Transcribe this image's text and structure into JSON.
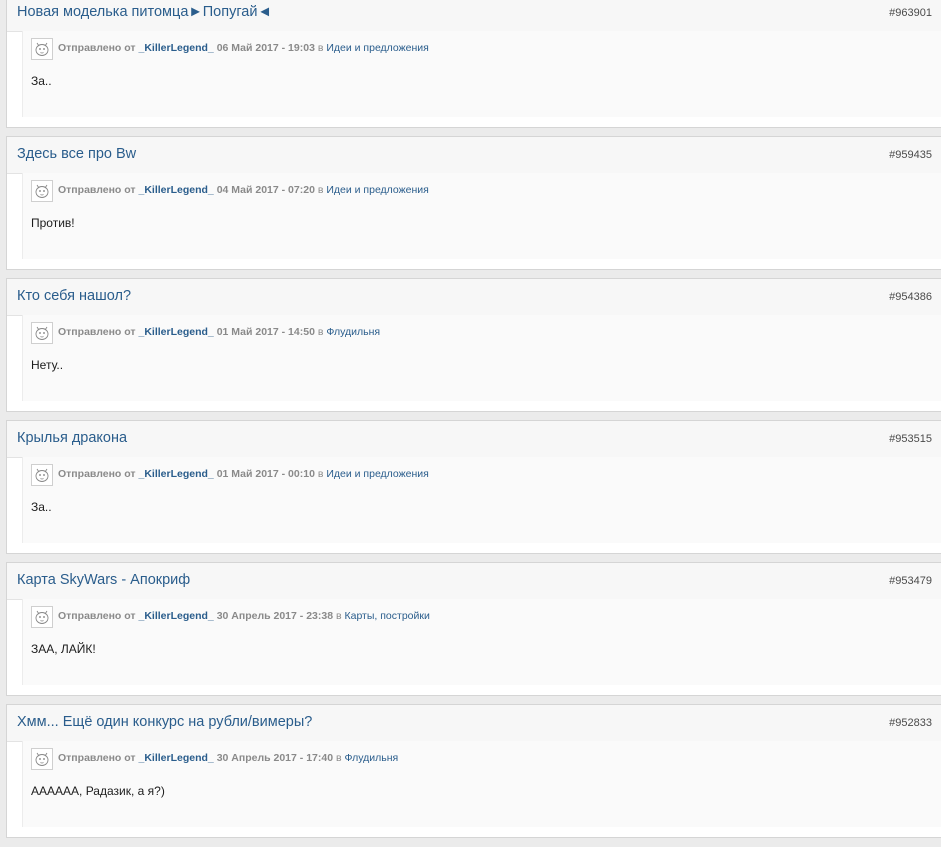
{
  "labels": {
    "sent_by": "Отправлено от",
    "in": "в"
  },
  "posts": [
    {
      "title": "Новая моделька питомца►Попугай◄",
      "id": "#963901",
      "author": "_KillerLegend_",
      "date": "06 Май 2017 - 19:03",
      "forum": "Идеи и предложения",
      "content": "За.."
    },
    {
      "title": "Здесь все про Bw",
      "id": "#959435",
      "author": "_KillerLegend_",
      "date": "04 Май 2017 - 07:20",
      "forum": "Идеи и предложения",
      "content": "Против!"
    },
    {
      "title": "Кто себя нашол?",
      "id": "#954386",
      "author": "_KillerLegend_",
      "date": "01 Май 2017 - 14:50",
      "forum": "Флудильня",
      "content": "Нету.."
    },
    {
      "title": "Крылья дракона",
      "id": "#953515",
      "author": "_KillerLegend_",
      "date": "01 Май 2017 - 00:10",
      "forum": "Идеи и предложения",
      "content": "За.."
    },
    {
      "title": "Карта SkyWars - Апокриф",
      "id": "#953479",
      "author": "_KillerLegend_",
      "date": "30 Апрель 2017 - 23:38",
      "forum": "Карты, постройки",
      "content": "ЗАА, ЛАЙК!"
    },
    {
      "title": "Хмм... Ещё один конкурс на рубли/вимеры?",
      "id": "#952833",
      "author": "_KillerLegend_",
      "date": "30 Апрель 2017 - 17:40",
      "forum": "Флудильня",
      "content": "АААААА, Радазик, а я?)"
    }
  ]
}
